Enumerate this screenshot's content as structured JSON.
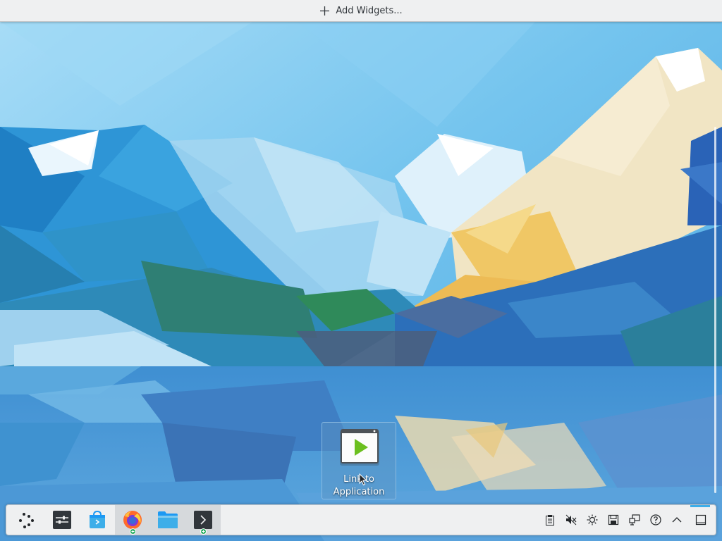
{
  "toolbar": {
    "add_widgets_label": "Add Widgets..."
  },
  "desktop_icons": [
    {
      "label": "Link to Application",
      "icon": "application-launcher-icon"
    }
  ],
  "panel": {
    "tasks": [
      {
        "name": "application-launcher",
        "icon": "kde-launcher-icon"
      },
      {
        "name": "system-settings",
        "icon": "settings-sliders-icon"
      },
      {
        "name": "discover",
        "icon": "store-bag-icon"
      },
      {
        "name": "firefox",
        "icon": "firefox-icon",
        "has_badge": true
      },
      {
        "name": "dolphin",
        "icon": "folder-icon"
      },
      {
        "name": "konsole",
        "icon": "terminal-icon",
        "has_badge": true
      }
    ],
    "tray": [
      "clipboard-icon",
      "volume-muted-icon",
      "brightness-icon",
      "disk-icon",
      "network-wired-icon",
      "help-icon",
      "expand-tray-icon"
    ],
    "show_desktop": "show-desktop-icon"
  },
  "colors": {
    "panel_bg": "#eff0f1",
    "accent": "#3daee9",
    "play_green": "#6bbf1f",
    "sky": "#7ec8f2"
  }
}
